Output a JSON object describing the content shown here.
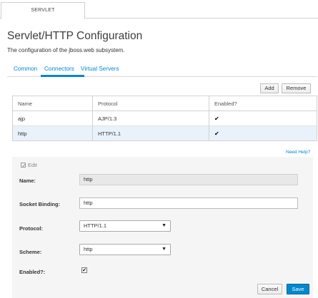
{
  "top_tab": {
    "label": "SERVLET"
  },
  "header": {
    "title": "Servlet/HTTP Configuration",
    "description": "The configuration of the jboss.web subsystem."
  },
  "subtabs": [
    {
      "label": "Common",
      "active": false
    },
    {
      "label": "Connectors",
      "active": true
    },
    {
      "label": "Virtual Servers",
      "active": false
    }
  ],
  "toolbar": {
    "add_label": "Add",
    "remove_label": "Remove"
  },
  "table": {
    "columns": [
      "Name",
      "Protocol",
      "Enabled?"
    ],
    "rows": [
      {
        "name": "ajp",
        "protocol": "AJP/1.3",
        "enabled": "✔",
        "selected": false
      },
      {
        "name": "http",
        "protocol": "HTTP/1.1",
        "enabled": "✔",
        "selected": true
      }
    ]
  },
  "help_link": "Need Help?",
  "form": {
    "edit_label": "Edit",
    "name_label": "Name:",
    "name_value": "http",
    "socket_label": "Socket Binding:",
    "socket_value": "http",
    "protocol_label": "Protocol:",
    "protocol_value": "HTTP/1.1",
    "scheme_label": "Scheme:",
    "scheme_value": "http",
    "enabled_label": "Enabled?:",
    "enabled_checked": "✔",
    "cancel_label": "Cancel",
    "save_label": "Save"
  },
  "colors": {
    "link": "#0088ce",
    "save_button": "#0088ce",
    "selected_row": "#e9f2fb"
  }
}
